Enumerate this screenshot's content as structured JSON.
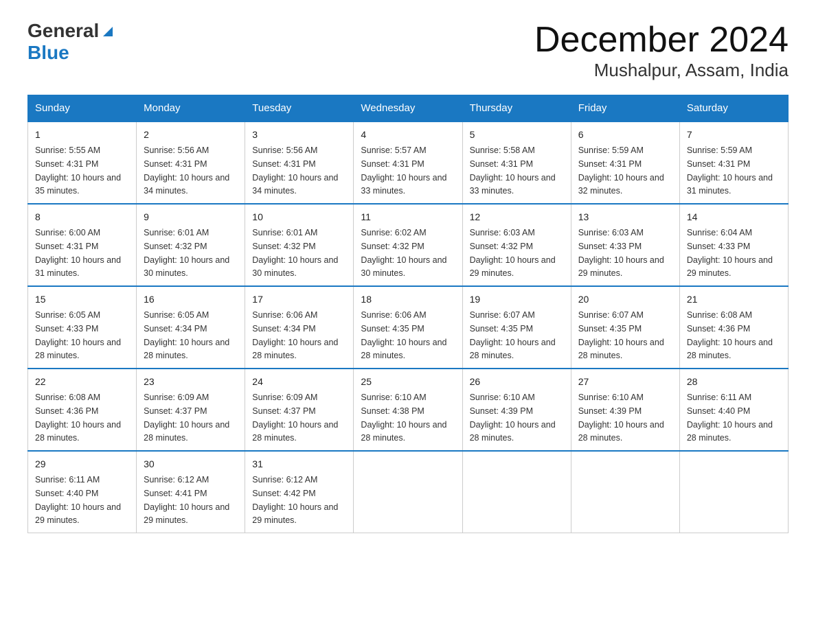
{
  "logo": {
    "general": "General",
    "blue": "Blue",
    "triangle": "▶"
  },
  "header": {
    "month": "December 2024",
    "location": "Mushalpur, Assam, India"
  },
  "days_of_week": [
    "Sunday",
    "Monday",
    "Tuesday",
    "Wednesday",
    "Thursday",
    "Friday",
    "Saturday"
  ],
  "weeks": [
    [
      {
        "day": "1",
        "sunrise": "5:55 AM",
        "sunset": "4:31 PM",
        "daylight": "10 hours and 35 minutes."
      },
      {
        "day": "2",
        "sunrise": "5:56 AM",
        "sunset": "4:31 PM",
        "daylight": "10 hours and 34 minutes."
      },
      {
        "day": "3",
        "sunrise": "5:56 AM",
        "sunset": "4:31 PM",
        "daylight": "10 hours and 34 minutes."
      },
      {
        "day": "4",
        "sunrise": "5:57 AM",
        "sunset": "4:31 PM",
        "daylight": "10 hours and 33 minutes."
      },
      {
        "day": "5",
        "sunrise": "5:58 AM",
        "sunset": "4:31 PM",
        "daylight": "10 hours and 33 minutes."
      },
      {
        "day": "6",
        "sunrise": "5:59 AM",
        "sunset": "4:31 PM",
        "daylight": "10 hours and 32 minutes."
      },
      {
        "day": "7",
        "sunrise": "5:59 AM",
        "sunset": "4:31 PM",
        "daylight": "10 hours and 31 minutes."
      }
    ],
    [
      {
        "day": "8",
        "sunrise": "6:00 AM",
        "sunset": "4:31 PM",
        "daylight": "10 hours and 31 minutes."
      },
      {
        "day": "9",
        "sunrise": "6:01 AM",
        "sunset": "4:32 PM",
        "daylight": "10 hours and 30 minutes."
      },
      {
        "day": "10",
        "sunrise": "6:01 AM",
        "sunset": "4:32 PM",
        "daylight": "10 hours and 30 minutes."
      },
      {
        "day": "11",
        "sunrise": "6:02 AM",
        "sunset": "4:32 PM",
        "daylight": "10 hours and 30 minutes."
      },
      {
        "day": "12",
        "sunrise": "6:03 AM",
        "sunset": "4:32 PM",
        "daylight": "10 hours and 29 minutes."
      },
      {
        "day": "13",
        "sunrise": "6:03 AM",
        "sunset": "4:33 PM",
        "daylight": "10 hours and 29 minutes."
      },
      {
        "day": "14",
        "sunrise": "6:04 AM",
        "sunset": "4:33 PM",
        "daylight": "10 hours and 29 minutes."
      }
    ],
    [
      {
        "day": "15",
        "sunrise": "6:05 AM",
        "sunset": "4:33 PM",
        "daylight": "10 hours and 28 minutes."
      },
      {
        "day": "16",
        "sunrise": "6:05 AM",
        "sunset": "4:34 PM",
        "daylight": "10 hours and 28 minutes."
      },
      {
        "day": "17",
        "sunrise": "6:06 AM",
        "sunset": "4:34 PM",
        "daylight": "10 hours and 28 minutes."
      },
      {
        "day": "18",
        "sunrise": "6:06 AM",
        "sunset": "4:35 PM",
        "daylight": "10 hours and 28 minutes."
      },
      {
        "day": "19",
        "sunrise": "6:07 AM",
        "sunset": "4:35 PM",
        "daylight": "10 hours and 28 minutes."
      },
      {
        "day": "20",
        "sunrise": "6:07 AM",
        "sunset": "4:35 PM",
        "daylight": "10 hours and 28 minutes."
      },
      {
        "day": "21",
        "sunrise": "6:08 AM",
        "sunset": "4:36 PM",
        "daylight": "10 hours and 28 minutes."
      }
    ],
    [
      {
        "day": "22",
        "sunrise": "6:08 AM",
        "sunset": "4:36 PM",
        "daylight": "10 hours and 28 minutes."
      },
      {
        "day": "23",
        "sunrise": "6:09 AM",
        "sunset": "4:37 PM",
        "daylight": "10 hours and 28 minutes."
      },
      {
        "day": "24",
        "sunrise": "6:09 AM",
        "sunset": "4:37 PM",
        "daylight": "10 hours and 28 minutes."
      },
      {
        "day": "25",
        "sunrise": "6:10 AM",
        "sunset": "4:38 PM",
        "daylight": "10 hours and 28 minutes."
      },
      {
        "day": "26",
        "sunrise": "6:10 AM",
        "sunset": "4:39 PM",
        "daylight": "10 hours and 28 minutes."
      },
      {
        "day": "27",
        "sunrise": "6:10 AM",
        "sunset": "4:39 PM",
        "daylight": "10 hours and 28 minutes."
      },
      {
        "day": "28",
        "sunrise": "6:11 AM",
        "sunset": "4:40 PM",
        "daylight": "10 hours and 28 minutes."
      }
    ],
    [
      {
        "day": "29",
        "sunrise": "6:11 AM",
        "sunset": "4:40 PM",
        "daylight": "10 hours and 29 minutes."
      },
      {
        "day": "30",
        "sunrise": "6:12 AM",
        "sunset": "4:41 PM",
        "daylight": "10 hours and 29 minutes."
      },
      {
        "day": "31",
        "sunrise": "6:12 AM",
        "sunset": "4:42 PM",
        "daylight": "10 hours and 29 minutes."
      },
      null,
      null,
      null,
      null
    ]
  ],
  "labels": {
    "sunrise": "Sunrise:",
    "sunset": "Sunset:",
    "daylight": "Daylight:"
  }
}
